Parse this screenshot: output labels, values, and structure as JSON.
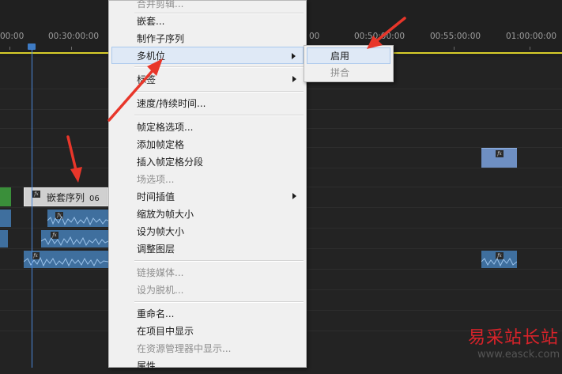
{
  "ruler": {
    "time_labels": [
      "00:00",
      "00:30:00:00",
      "00",
      "00:50:00:00",
      "00:55:00:00",
      "01:00:00:00"
    ]
  },
  "clips": {
    "nested_sequence": {
      "label": "嵌套序列",
      "suffix": "06"
    },
    "fx_badge": "fx"
  },
  "context_menu": {
    "items": [
      {
        "label": "合并剪辑...",
        "disabled": true
      },
      {
        "label": "嵌套..."
      },
      {
        "label": "制作子序列"
      },
      {
        "label": "多机位",
        "submenu": true,
        "highlighted": true
      },
      {
        "label": "标签",
        "submenu": true
      },
      {
        "label": "速度/持续时间..."
      },
      {
        "label": "帧定格选项..."
      },
      {
        "label": "添加帧定格"
      },
      {
        "label": "插入帧定格分段"
      },
      {
        "label": "场选项...",
        "disabled": true
      },
      {
        "label": "时间插值",
        "submenu": true
      },
      {
        "label": "缩放为帧大小"
      },
      {
        "label": "设为帧大小"
      },
      {
        "label": "调整图层"
      },
      {
        "label": "链接媒体...",
        "disabled": true
      },
      {
        "label": "设为脱机...",
        "disabled": true
      },
      {
        "label": "重命名..."
      },
      {
        "label": "在项目中显示"
      },
      {
        "label": "在资源管理器中显示...",
        "disabled": true
      },
      {
        "label": "属性"
      }
    ]
  },
  "multicam_submenu": {
    "items": [
      {
        "label": "启用",
        "highlighted": true
      },
      {
        "label": "拼合",
        "disabled": true
      }
    ]
  },
  "watermark": {
    "text": "易采站长站",
    "url": "www.easck.com"
  },
  "colors": {
    "background": "#232323",
    "menu_bg": "#f0f0f0",
    "highlight": "#dfe9f6",
    "annotation_arrow": "#e8362a",
    "clip_video": "#6e8fc2",
    "clip_audio": "#3f6f9e",
    "work_area": "#d8cd2a",
    "playhead": "#4a86d8"
  }
}
